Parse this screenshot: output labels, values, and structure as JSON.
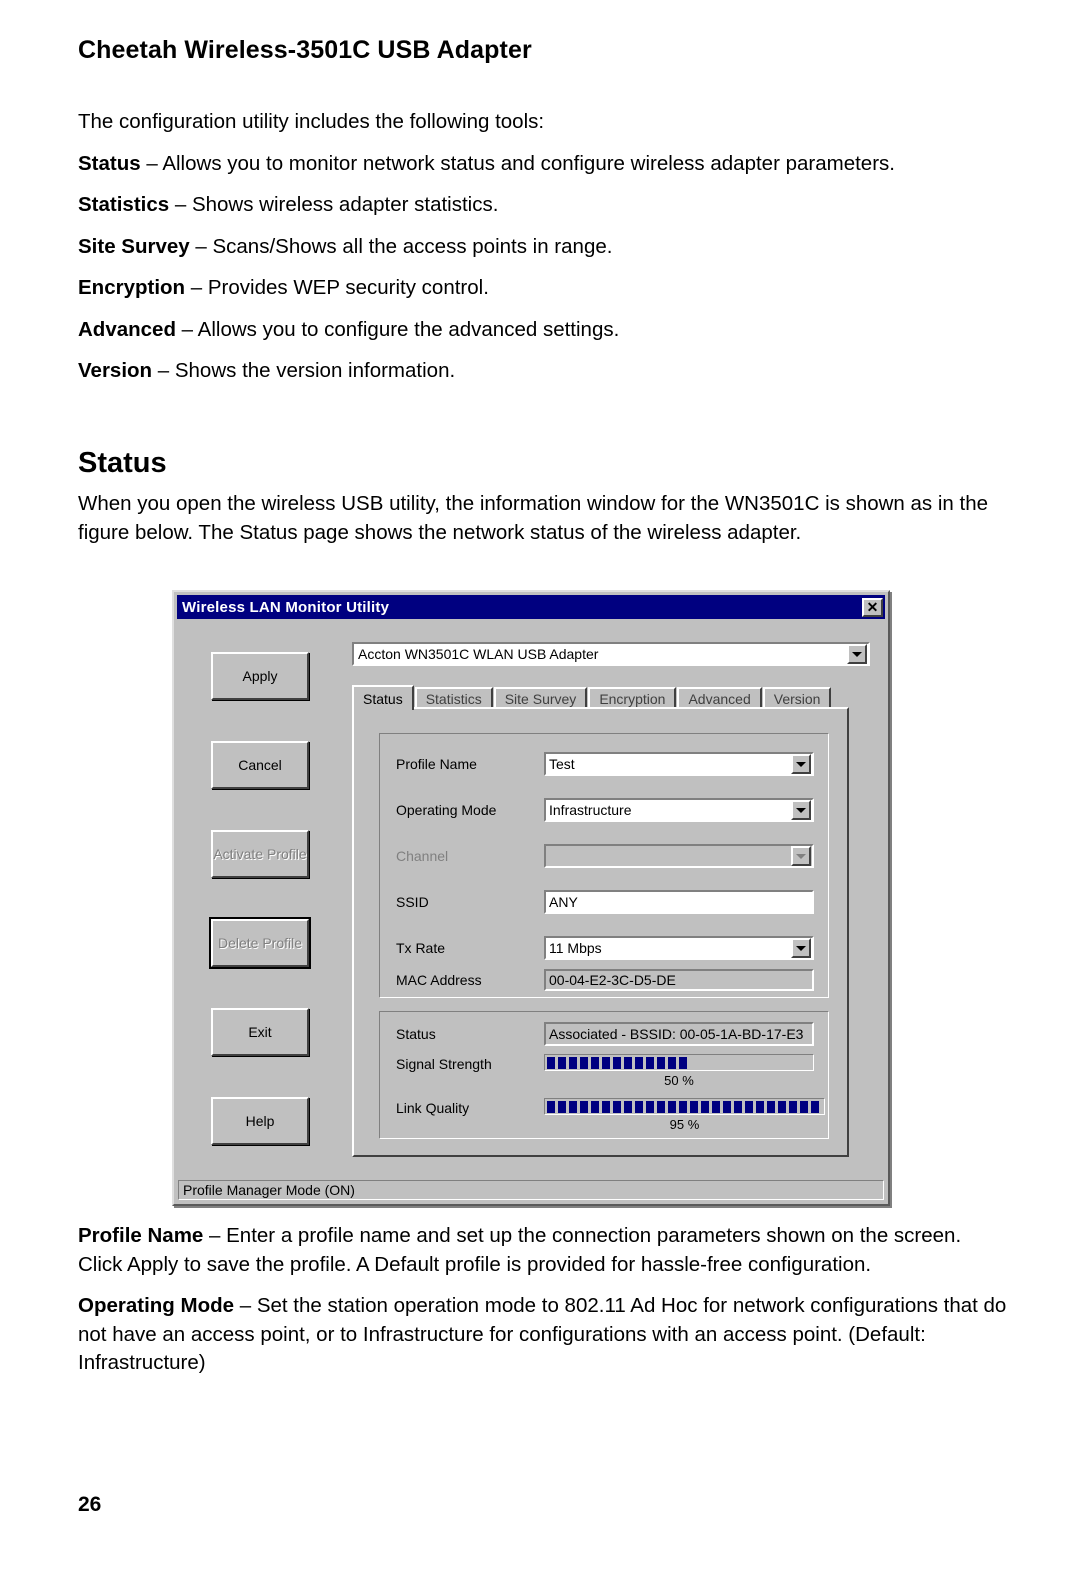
{
  "document": {
    "header": "Cheetah Wireless-3501C USB Adapter",
    "intro_line": "The configuration utility includes the following tools:",
    "tools": [
      {
        "term": "Status",
        "dash": " – ",
        "desc": "Allows you to monitor network status and configure wireless adapter parameters."
      },
      {
        "term": "Statistics",
        "dash": " – ",
        "desc": "Shows wireless adapter statistics."
      },
      {
        "term": "Site Survey",
        "dash": " – ",
        "desc": "Scans/Shows all the access points in range."
      },
      {
        "term": "Encryption",
        "dash": " – ",
        "desc": "Provides WEP security control."
      },
      {
        "term": "Advanced",
        "dash": " – ",
        "desc": "Allows you to configure the advanced settings."
      },
      {
        "term": "Version",
        "dash": " – ",
        "desc": "Shows the version information."
      }
    ],
    "section_title": "Status",
    "section_intro": "When you open the wireless USB utility, the information window for the WN3501C is shown as in the figure below. The Status page shows the network status of the wireless adapter.",
    "notes": [
      {
        "term": "Profile Name",
        "dash": " – ",
        "desc": "Enter a profile name and set up the connection parameters shown on the screen. Click Apply to save the profile. A Default profile is provided for hassle-free configuration."
      },
      {
        "term": "Operating Mode",
        "dash": " – ",
        "desc": "Set the station operation mode to 802.11 Ad Hoc for network configurations that do not have an access point, or to Infrastructure for configurations with an access point. (Default: Infrastructure)"
      }
    ],
    "page_number": "26"
  },
  "dialog": {
    "title": "Wireless LAN Monitor Utility",
    "close_glyph": "✕",
    "adapter": {
      "value": "Accton WN3501C WLAN USB Adapter"
    },
    "buttons": [
      {
        "label": "Apply",
        "accel": "A",
        "rest": "pply",
        "disabled": false,
        "focus": false
      },
      {
        "label": "Cancel",
        "accel": "",
        "rest": "Cancel",
        "disabled": false,
        "focus": false
      },
      {
        "label": "Activate Profile",
        "accel": "A",
        "rest": "ctivate\nProfile",
        "disabled": true,
        "focus": false
      },
      {
        "label": "Delete Profile",
        "accel": "D",
        "rest": "elete\nProfile",
        "disabled": true,
        "focus": true
      },
      {
        "label": "Exit",
        "accel": "",
        "rest": "Exit",
        "disabled": false,
        "focus": false
      },
      {
        "label": "Help",
        "accel": "",
        "rest": "Help",
        "disabled": false,
        "focus": false
      }
    ],
    "tabs": [
      {
        "label": "Status",
        "active": true
      },
      {
        "label": "Statistics",
        "active": false
      },
      {
        "label": "Site Survey",
        "active": false
      },
      {
        "label": "Encryption",
        "active": false
      },
      {
        "label": "Advanced",
        "active": false
      },
      {
        "label": "Version",
        "active": false
      }
    ],
    "profile_fields": {
      "profile_name_label": "Profile Name",
      "profile_name_value": "Test",
      "operating_mode_label": "Operating Mode",
      "operating_mode_value": "Infrastructure",
      "channel_label": "Channel",
      "channel_value": "",
      "ssid_label": "SSID",
      "ssid_value": "ANY",
      "tx_rate_label": "Tx Rate",
      "tx_rate_value": "11 Mbps",
      "mac_address_label": "MAC Address",
      "mac_address_value": "00-04-E2-3C-D5-DE"
    },
    "status_panel": {
      "status_label": "Status",
      "status_value": "Associated - BSSID: 00-05-1A-BD-17-E3",
      "signal_label": "Signal Strength",
      "signal_percent": "50 %",
      "signal_blocks": 13,
      "link_label": "Link Quality",
      "link_percent": "95 %",
      "link_blocks": 25,
      "meter_color": "#000080"
    },
    "statusbar": "Profile Manager Mode (ON)"
  }
}
